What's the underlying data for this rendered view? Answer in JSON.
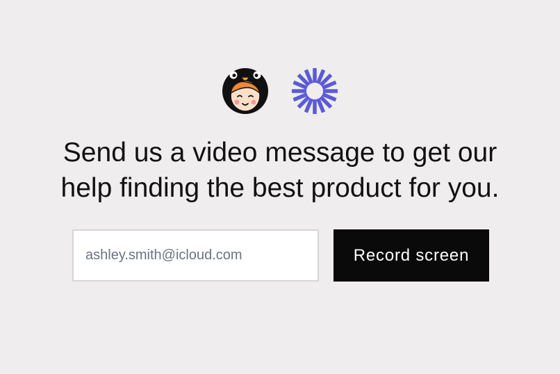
{
  "logos": [
    {
      "icon": "girl-in-penguin-hood-avatar-icon"
    },
    {
      "icon": "purple-sunburst-logo-icon",
      "color": "#5b5bd6"
    }
  ],
  "headline": {
    "line1": "Send us a video message to get our",
    "line2": "help finding the best product for you."
  },
  "form": {
    "email_value": "ashley.smith@icloud.com",
    "button_label": "Record screen"
  },
  "colors": {
    "background": "#efedee",
    "button_background": "#0a0a0a",
    "button_text": "#ffffff",
    "input_text": "#6b7280",
    "accent": "#5b5bd6"
  }
}
